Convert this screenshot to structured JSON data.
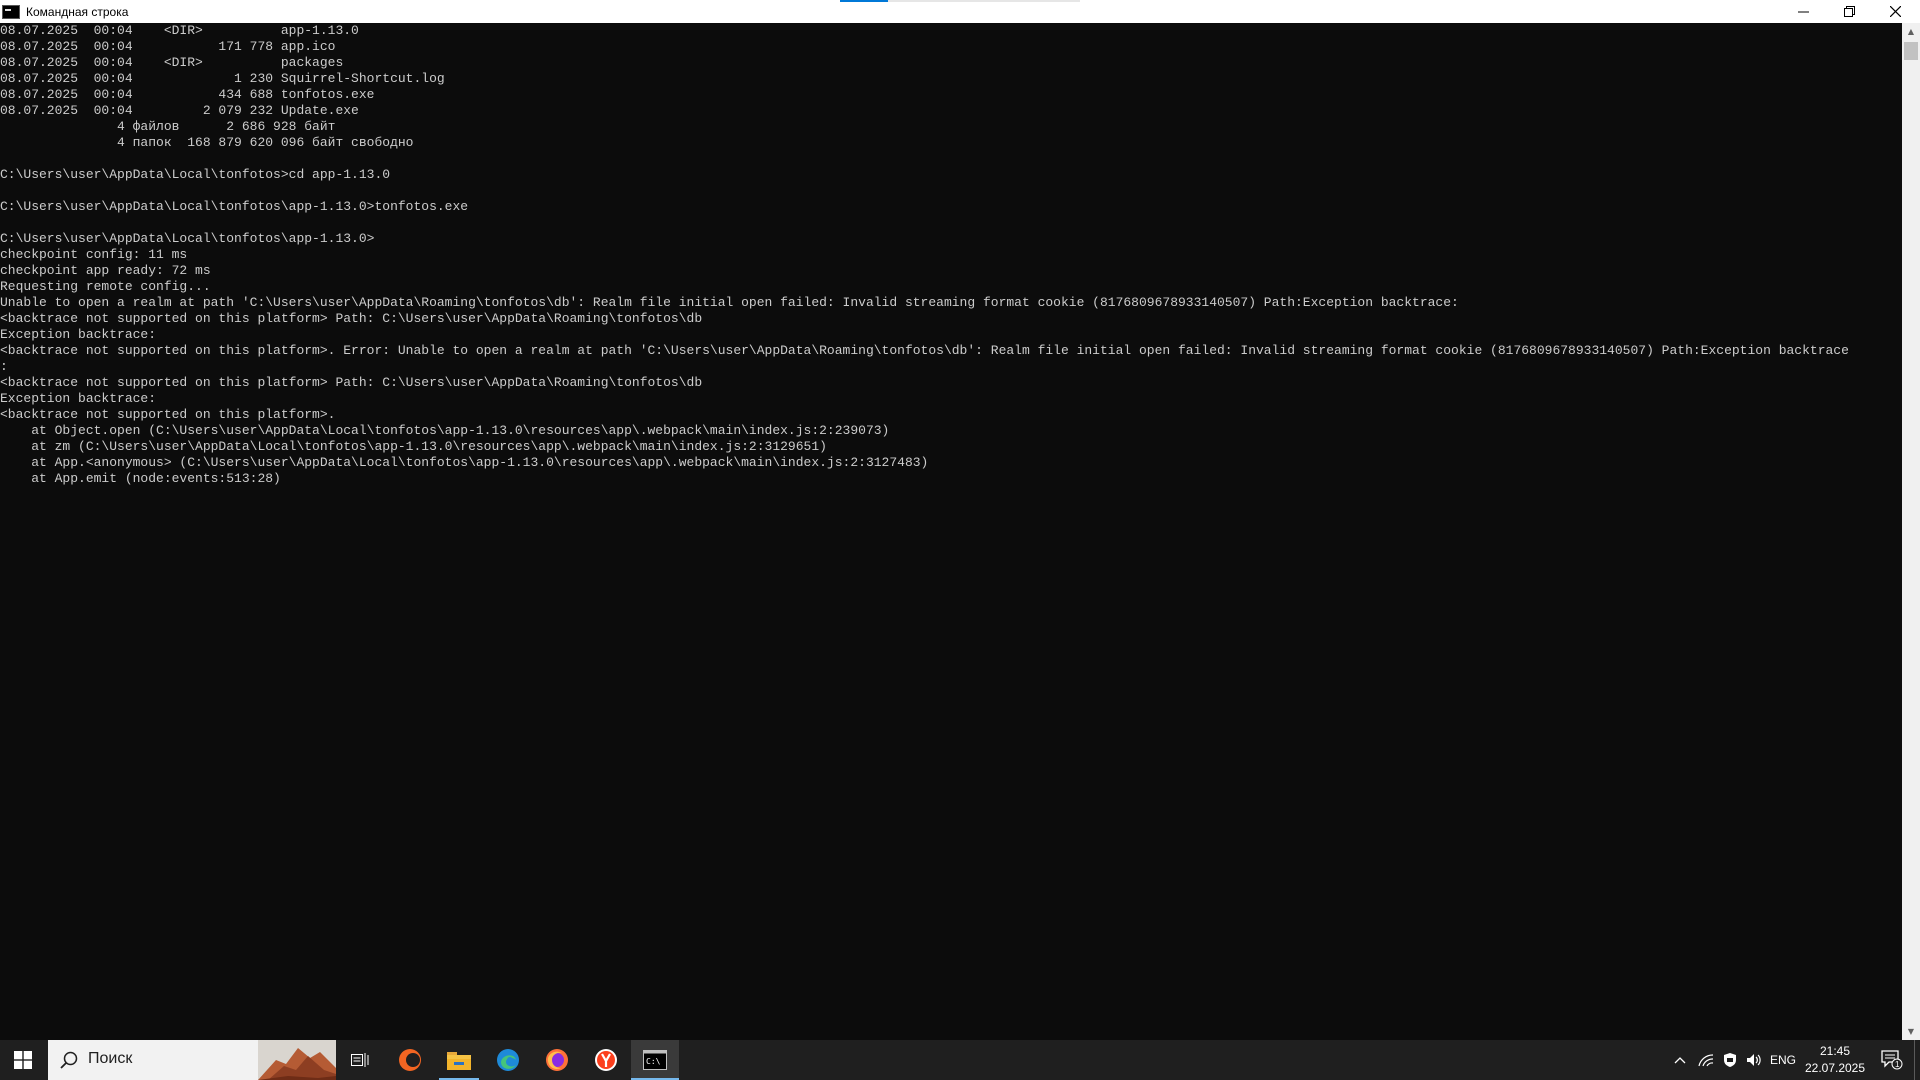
{
  "window": {
    "title": "Командная строка",
    "controls": {
      "minimize": "—",
      "maximize": "❐",
      "close": "✕"
    }
  },
  "terminal": {
    "lines": [
      "08.07.2025  00:04    <DIR>          app-1.13.0",
      "08.07.2025  00:04           171 778 app.ico",
      "08.07.2025  00:04    <DIR>          packages",
      "08.07.2025  00:04             1 230 Squirrel-Shortcut.log",
      "08.07.2025  00:04           434 688 tonfotos.exe",
      "08.07.2025  00:04         2 079 232 Update.exe",
      "               4 файлов      2 686 928 байт",
      "               4 папок  168 879 620 096 байт свободно",
      "",
      "C:\\Users\\user\\AppData\\Local\\tonfotos>cd app-1.13.0",
      "",
      "C:\\Users\\user\\AppData\\Local\\tonfotos\\app-1.13.0>tonfotos.exe",
      "",
      "C:\\Users\\user\\AppData\\Local\\tonfotos\\app-1.13.0>",
      "checkpoint config: 11 ms",
      "checkpoint app ready: 72 ms",
      "Requesting remote config...",
      "Unable to open a realm at path 'C:\\Users\\user\\AppData\\Roaming\\tonfotos\\db': Realm file initial open failed: Invalid streaming format cookie (8176809678933140507) Path:Exception backtrace:",
      "<backtrace not supported on this platform> Path: C:\\Users\\user\\AppData\\Roaming\\tonfotos\\db",
      "Exception backtrace:",
      "<backtrace not supported on this platform>. Error: Unable to open a realm at path 'C:\\Users\\user\\AppData\\Roaming\\tonfotos\\db': Realm file initial open failed: Invalid streaming format cookie (8176809678933140507) Path:Exception backtrace",
      ":",
      "<backtrace not supported on this platform> Path: C:\\Users\\user\\AppData\\Roaming\\tonfotos\\db",
      "Exception backtrace:",
      "<backtrace not supported on this platform>.",
      "    at Object.open (C:\\Users\\user\\AppData\\Local\\tonfotos\\app-1.13.0\\resources\\app\\.webpack\\main\\index.js:2:239073)",
      "    at zm (C:\\Users\\user\\AppData\\Local\\tonfotos\\app-1.13.0\\resources\\app\\.webpack\\main\\index.js:2:3129651)",
      "    at App.<anonymous> (C:\\Users\\user\\AppData\\Local\\tonfotos\\app-1.13.0\\resources\\app\\.webpack\\main\\index.js:2:3127483)",
      "    at App.emit (node:events:513:28)"
    ]
  },
  "taskbar": {
    "search_placeholder": "Поиск",
    "apps": [
      {
        "name": "task-view-icon"
      },
      {
        "name": "browser-orange-icon"
      },
      {
        "name": "file-explorer-icon"
      },
      {
        "name": "edge-icon"
      },
      {
        "name": "firefox-icon"
      },
      {
        "name": "yandex-browser-icon"
      },
      {
        "name": "cmd-icon",
        "active": true
      }
    ],
    "tray": {
      "language": "ENG",
      "time": "21:45",
      "date": "22.07.2025",
      "notification_count": "1"
    }
  },
  "colors": {
    "terminal_bg": "#0c0c0c",
    "terminal_text": "#cccccc",
    "taskbar_bg": "#1f1f1f",
    "accent": "#76b9ed"
  }
}
